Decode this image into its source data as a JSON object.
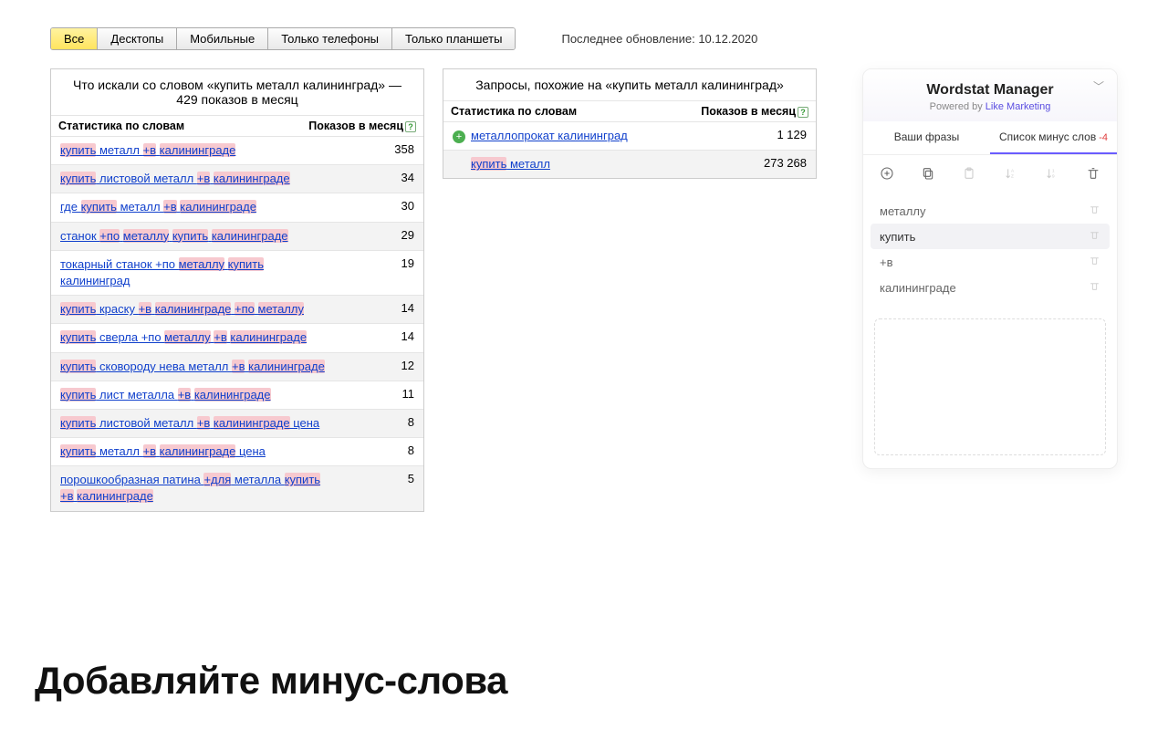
{
  "device_tabs": [
    "Все",
    "Десктопы",
    "Мобильные",
    "Только телефоны",
    "Только планшеты"
  ],
  "device_active": 0,
  "last_update_label": "Последнее обновление: 10.12.2020",
  "left_panel": {
    "title": "Что искали со словом «купить металл калининград» — 429 показов в месяц",
    "head_left": "Статистика по словам",
    "head_right": "Показов в месяц",
    "rows": [
      {
        "segments": [
          [
            "купить",
            true
          ],
          [
            " металл ",
            false
          ],
          [
            "+в",
            true
          ],
          [
            " ",
            false
          ],
          [
            "калининграде",
            true
          ]
        ],
        "count": "358"
      },
      {
        "segments": [
          [
            "купить",
            true
          ],
          [
            " листовой металл ",
            false
          ],
          [
            "+в",
            true
          ],
          [
            " ",
            false
          ],
          [
            "калининграде",
            true
          ]
        ],
        "count": "34"
      },
      {
        "segments": [
          [
            "где ",
            false
          ],
          [
            "купить",
            true
          ],
          [
            " металл ",
            false
          ],
          [
            "+в",
            true
          ],
          [
            " ",
            false
          ],
          [
            "калининграде",
            true
          ]
        ],
        "count": "30"
      },
      {
        "segments": [
          [
            "станок ",
            false
          ],
          [
            "+по",
            true
          ],
          [
            " ",
            false
          ],
          [
            "металлу",
            true
          ],
          [
            " ",
            false
          ],
          [
            "купить",
            true
          ],
          [
            " ",
            false
          ],
          [
            "калининграде",
            true
          ]
        ],
        "count": "29"
      },
      {
        "segments": [
          [
            "токарный станок +по ",
            false
          ],
          [
            "металлу",
            true
          ],
          [
            " ",
            false
          ],
          [
            "купить",
            true
          ],
          [
            " калининград",
            false
          ]
        ],
        "count": "19"
      },
      {
        "segments": [
          [
            "купить",
            true
          ],
          [
            " краску ",
            false
          ],
          [
            "+в",
            true
          ],
          [
            " ",
            false
          ],
          [
            "калининграде",
            true
          ],
          [
            " ",
            false
          ],
          [
            "+по",
            true
          ],
          [
            " ",
            false
          ],
          [
            "металлу",
            true
          ]
        ],
        "count": "14"
      },
      {
        "segments": [
          [
            "купить",
            true
          ],
          [
            " сверла +по ",
            false
          ],
          [
            "металлу",
            true
          ],
          [
            " ",
            false
          ],
          [
            "+в",
            true
          ],
          [
            " ",
            false
          ],
          [
            "калининграде",
            true
          ]
        ],
        "count": "14"
      },
      {
        "segments": [
          [
            "купить",
            true
          ],
          [
            " сковороду нева металл ",
            false
          ],
          [
            "+в",
            true
          ],
          [
            " ",
            false
          ],
          [
            "калининграде",
            true
          ]
        ],
        "count": "12"
      },
      {
        "segments": [
          [
            "купить",
            true
          ],
          [
            " лист металла ",
            false
          ],
          [
            "+в",
            true
          ],
          [
            " ",
            false
          ],
          [
            "калининграде",
            true
          ]
        ],
        "count": "11"
      },
      {
        "segments": [
          [
            "купить",
            true
          ],
          [
            " листовой металл ",
            false
          ],
          [
            "+в",
            true
          ],
          [
            " ",
            false
          ],
          [
            "калининграде",
            true
          ],
          [
            " цена",
            false
          ]
        ],
        "count": "8"
      },
      {
        "segments": [
          [
            "купить",
            true
          ],
          [
            " металл ",
            false
          ],
          [
            "+в",
            true
          ],
          [
            " ",
            false
          ],
          [
            "калининграде",
            true
          ],
          [
            " цена",
            false
          ]
        ],
        "count": "8"
      },
      {
        "segments": [
          [
            "порошкообразная патина ",
            false
          ],
          [
            "+для",
            true
          ],
          [
            " металла ",
            false
          ],
          [
            "купить",
            true
          ],
          [
            " ",
            false
          ],
          [
            "+в",
            true
          ],
          [
            " ",
            false
          ],
          [
            "калининграде",
            true
          ]
        ],
        "count": "5"
      }
    ]
  },
  "right_panel": {
    "title": "Запросы, похожие на «купить металл калининград»",
    "head_left": "Статистика по словам",
    "head_right": "Показов в месяц",
    "rows": [
      {
        "plus": true,
        "segments": [
          [
            "металлопрокат калининград",
            false
          ]
        ],
        "count": "1 129"
      },
      {
        "plus": false,
        "segments": [
          [
            "купить",
            true
          ],
          [
            " металл",
            false
          ]
        ],
        "count": "273 268"
      }
    ]
  },
  "widget": {
    "title": "Wordstat Manager",
    "subtitle_prefix": "Powered by ",
    "subtitle_link": "Like Marketing",
    "tabs": {
      "phrases": "Ваши фразы",
      "minus": "Список минус слов",
      "minus_count": "-4"
    },
    "items": [
      {
        "text": "металлу",
        "selected": false
      },
      {
        "text": "купить",
        "selected": true
      },
      {
        "text": "+в",
        "selected": false
      },
      {
        "text": "калининграде",
        "selected": false
      }
    ]
  },
  "caption": "Добавляйте минус-слова"
}
